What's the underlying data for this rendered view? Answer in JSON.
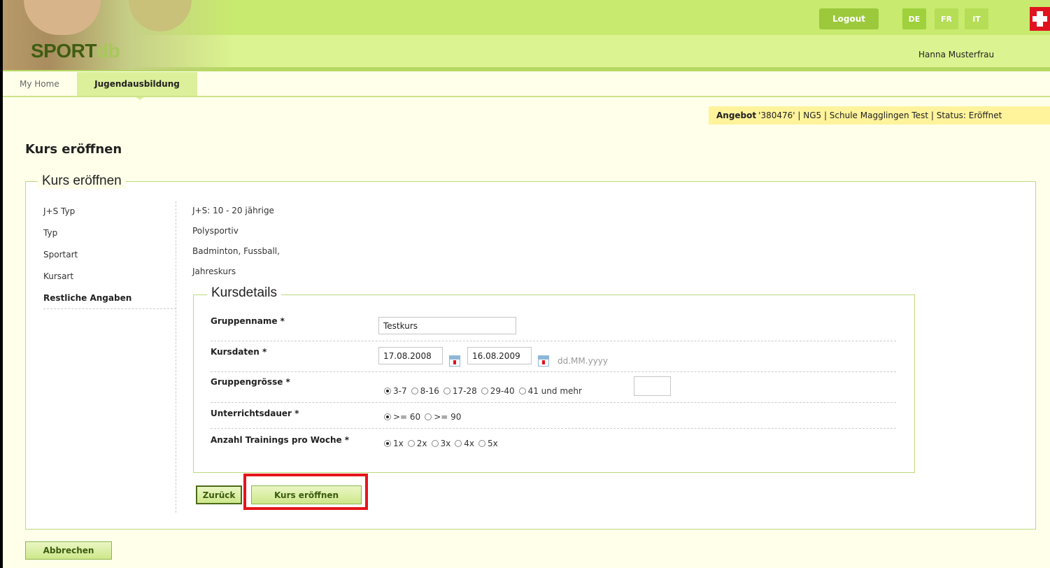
{
  "header": {
    "logo_sport": "SPORT",
    "logo_db": "db",
    "logout_label": "Logout",
    "languages": [
      {
        "code": "DE",
        "active": true
      },
      {
        "code": "FR",
        "active": false
      },
      {
        "code": "IT",
        "active": false
      }
    ],
    "user_name": "Hanna Musterfrau"
  },
  "nav": {
    "items": [
      {
        "label": "My Home",
        "active": false
      },
      {
        "label": "Jugendausbildung",
        "active": true
      }
    ]
  },
  "infobar": {
    "label": "Angebot",
    "text": "'380476' | NG5 | Schule Magglingen Test | Status: Eröffnet"
  },
  "page_title": "Kurs eröffnen",
  "wizard": {
    "legend": "Kurs eröffnen",
    "steps": [
      {
        "label": "J+S Typ",
        "value": "J+S: 10 - 20 jährige"
      },
      {
        "label": "Typ",
        "value": "Polysportiv"
      },
      {
        "label": "Sportart",
        "value": "Badminton, Fussball,"
      },
      {
        "label": "Kursart",
        "value": "Jahreskurs"
      },
      {
        "label": "Restliche Angaben",
        "current": true
      }
    ]
  },
  "kursdetails": {
    "legend": "Kursdetails",
    "gruppenname_label": "Gruppenname *",
    "gruppenname_value": "Testkurs",
    "kursdaten_label": "Kursdaten *",
    "kursdaten_from": "17.08.2008",
    "kursdaten_to": "16.08.2009",
    "kursdaten_format": "dd.MM.yyyy",
    "gruppengroesse_label": "Gruppengrösse *",
    "gruppengroesse_options": [
      "3-7",
      "8-16",
      "17-28",
      "29-40",
      "41 und mehr"
    ],
    "gruppengroesse_selected": "3-7",
    "unterrichtsdauer_label": "Unterrichtsdauer *",
    "unterrichtsdauer_options": [
      ">= 60",
      ">= 90"
    ],
    "unterrichtsdauer_selected": ">= 60",
    "trainings_label": "Anzahl Trainings pro Woche *",
    "trainings_options": [
      "1x",
      "2x",
      "3x",
      "4x",
      "5x"
    ],
    "trainings_selected": "1x"
  },
  "buttons": {
    "back": "Zurück",
    "open_course": "Kurs eröffnen",
    "cancel": "Abbrechen"
  },
  "colors": {
    "header_green": "#c8ea6e",
    "accent_green": "#9cc93c",
    "highlight_red": "#e4151b",
    "info_yellow": "#fff39c"
  }
}
